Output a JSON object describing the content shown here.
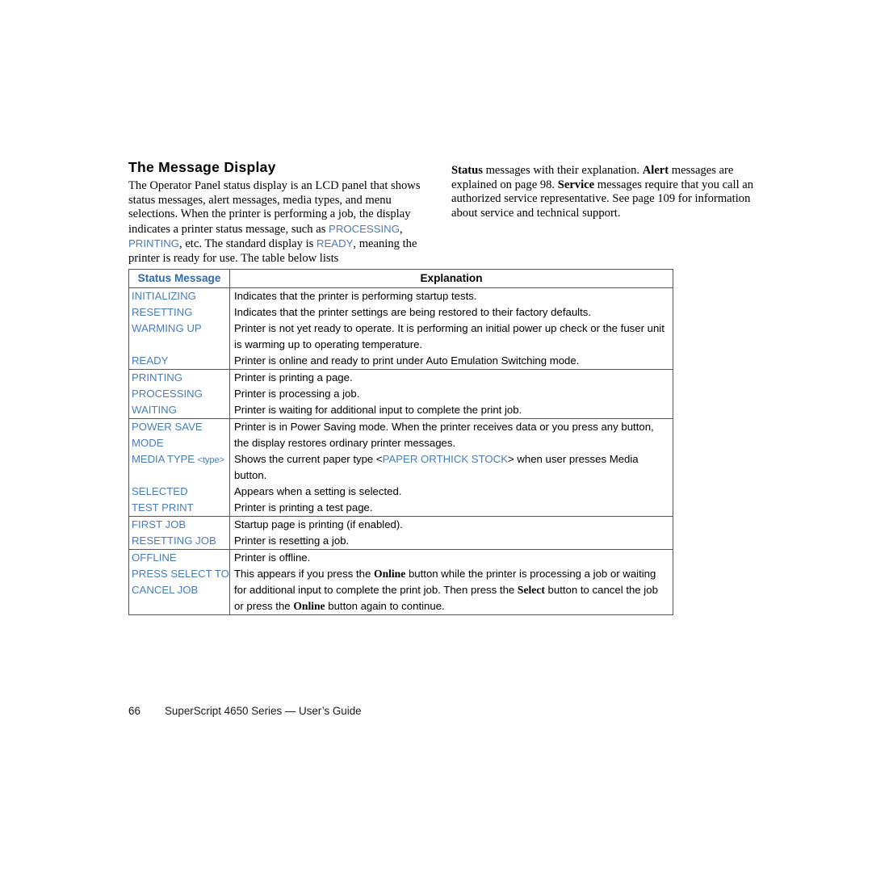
{
  "document": {
    "heading": "The Message Display",
    "intro_left": {
      "part1": "The Operator Panel status display is an LCD panel that shows status messages, alert messages, media types, and menu selections. When the printer is performing a job, the display indicates a printer status message, such as ",
      "term1": "PROCESSING",
      "sep1": ", ",
      "term2": "PRINTING",
      "part2": ", etc. The standard display is ",
      "term3": "READY",
      "part3": ", meaning the printer is ready for use. The table below lists "
    },
    "intro_right": {
      "bold1": "Status",
      "part1": " messages with their explanation. ",
      "bold2": "Alert",
      "part2": " messages are explained on page 98. ",
      "bold3": "Service",
      "part3": " messages require that you call an authorized service representative. See page 109 for information about service and technical support."
    },
    "table": {
      "headers": {
        "status": "Status Message",
        "explanation": "Explanation"
      },
      "groups": [
        {
          "rows": [
            {
              "message": "INITIALIZING",
              "explanation": "Indicates that the printer is performing startup tests."
            },
            {
              "message": "RESETTING",
              "explanation": "Indicates that the printer settings are being restored to their factory defaults."
            },
            {
              "message": "WARMING UP",
              "explanation": "Printer is not yet ready to operate. It is performing an initial power up check or the fuser unit is warming up to operating temperature."
            },
            {
              "message": "READY",
              "explanation": "Printer is online and ready to print under Auto Emulation Switching mode."
            }
          ]
        },
        {
          "rows": [
            {
              "message": "PRINTING",
              "explanation": "Printer is printing a page."
            },
            {
              "message": "PROCESSING",
              "explanation": "Printer is processing a job."
            },
            {
              "message": "WAITING",
              "explanation": "Printer is waiting for additional input to complete the print job."
            }
          ]
        },
        {
          "rows": [
            {
              "message": "POWER SAVE MODE",
              "message_line1": "POWER SAVE",
              "message_line2": "MODE",
              "explanation": "Printer is in Power Saving mode. When the printer receives data or you press any button, the display restores ordinary printer messages."
            },
            {
              "message": "MEDIA TYPE <type>",
              "message_main": "MEDIA TYPE ",
              "message_sub": "<type>",
              "explanation_part1": "Shows the current paper type <",
              "explanation_blue": "PAPER ORTHICK STOCK",
              "explanation_part2": "> when user presses Media button."
            },
            {
              "message": "SELECTED",
              "explanation": "Appears when a setting is selected."
            },
            {
              "message": "TEST PRINT",
              "explanation": "Printer is printing a test page."
            }
          ]
        },
        {
          "rows": [
            {
              "message": "FIRST JOB",
              "explanation": "Startup page is printing (if enabled)."
            },
            {
              "message": "RESETTING JOB",
              "explanation": "Printer is resetting a job."
            }
          ]
        },
        {
          "rows": [
            {
              "message": "OFFLINE",
              "explanation": "Printer is offline."
            },
            {
              "message": "PRESS SELECT TO CANCEL JOB",
              "message_line1": "PRESS SELECT TO",
              "message_line2": "CANCEL JOB",
              "explanation_part1": "This appears if you press the ",
              "explanation_bold1": "Online",
              "explanation_part2": " button while the printer is processing a job or waiting for additional input to complete the print job. Then press the ",
              "explanation_bold2": "Select",
              "explanation_part3": " button to cancel the job or press the ",
              "explanation_bold3": "Online",
              "explanation_part4": " button again to continue."
            }
          ]
        }
      ]
    },
    "footer": {
      "page_number": "66",
      "text": "SuperScript 4650 Series — User’s Guide"
    },
    "colors": {
      "message_blue": "#4a7ebb",
      "header_blue": "#2f6bb0",
      "rule": "#555555"
    }
  }
}
